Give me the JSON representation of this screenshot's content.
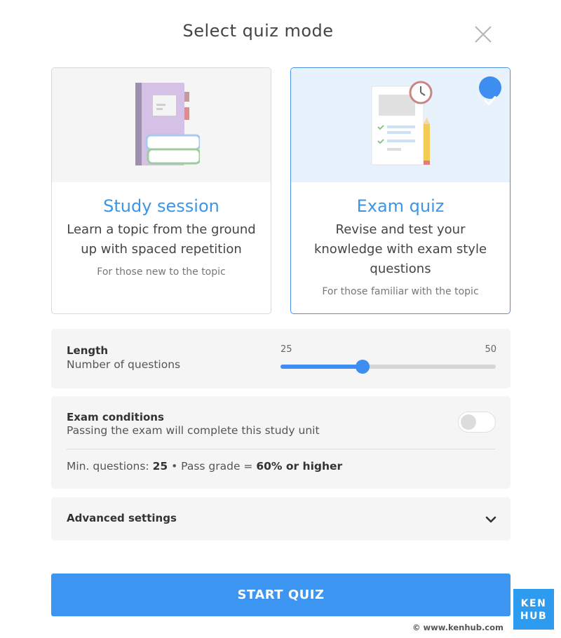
{
  "modal": {
    "title": "Select quiz mode"
  },
  "modes": [
    {
      "title": "Study session",
      "description": "Learn a topic from the ground up with spaced repetition",
      "subtitle": "For those new to the topic",
      "selected": false,
      "icon": "notebook-books-icon"
    },
    {
      "title": "Exam quiz",
      "description": "Revise and test your knowledge with exam style questions",
      "subtitle": "For those familiar with the topic",
      "selected": true,
      "icon": "exam-sheet-clock-icon"
    }
  ],
  "length": {
    "label": "Length",
    "sublabel": "Number of questions",
    "min_label": "25",
    "max_label": "50",
    "value_fraction": 0.38
  },
  "exam_conditions": {
    "label": "Exam conditions",
    "sublabel": "Passing the exam will complete this study unit",
    "enabled": false,
    "min_questions_label": "Min. questions:",
    "min_questions_value": "25",
    "separator": "•",
    "pass_grade_label": "Pass grade =",
    "pass_grade_value": "60% or higher"
  },
  "advanced": {
    "label": "Advanced settings",
    "expanded": false
  },
  "actions": {
    "start_label": "START QUIZ"
  },
  "branding": {
    "logo_top": "KEN",
    "logo_bottom": "HUB",
    "copyright": "© www.kenhub.com"
  },
  "colors": {
    "accent": "#3d95f2",
    "selected_bg": "#e7f2fd",
    "panel_bg": "#f5f5f5",
    "logo": "#2d9cf0"
  }
}
